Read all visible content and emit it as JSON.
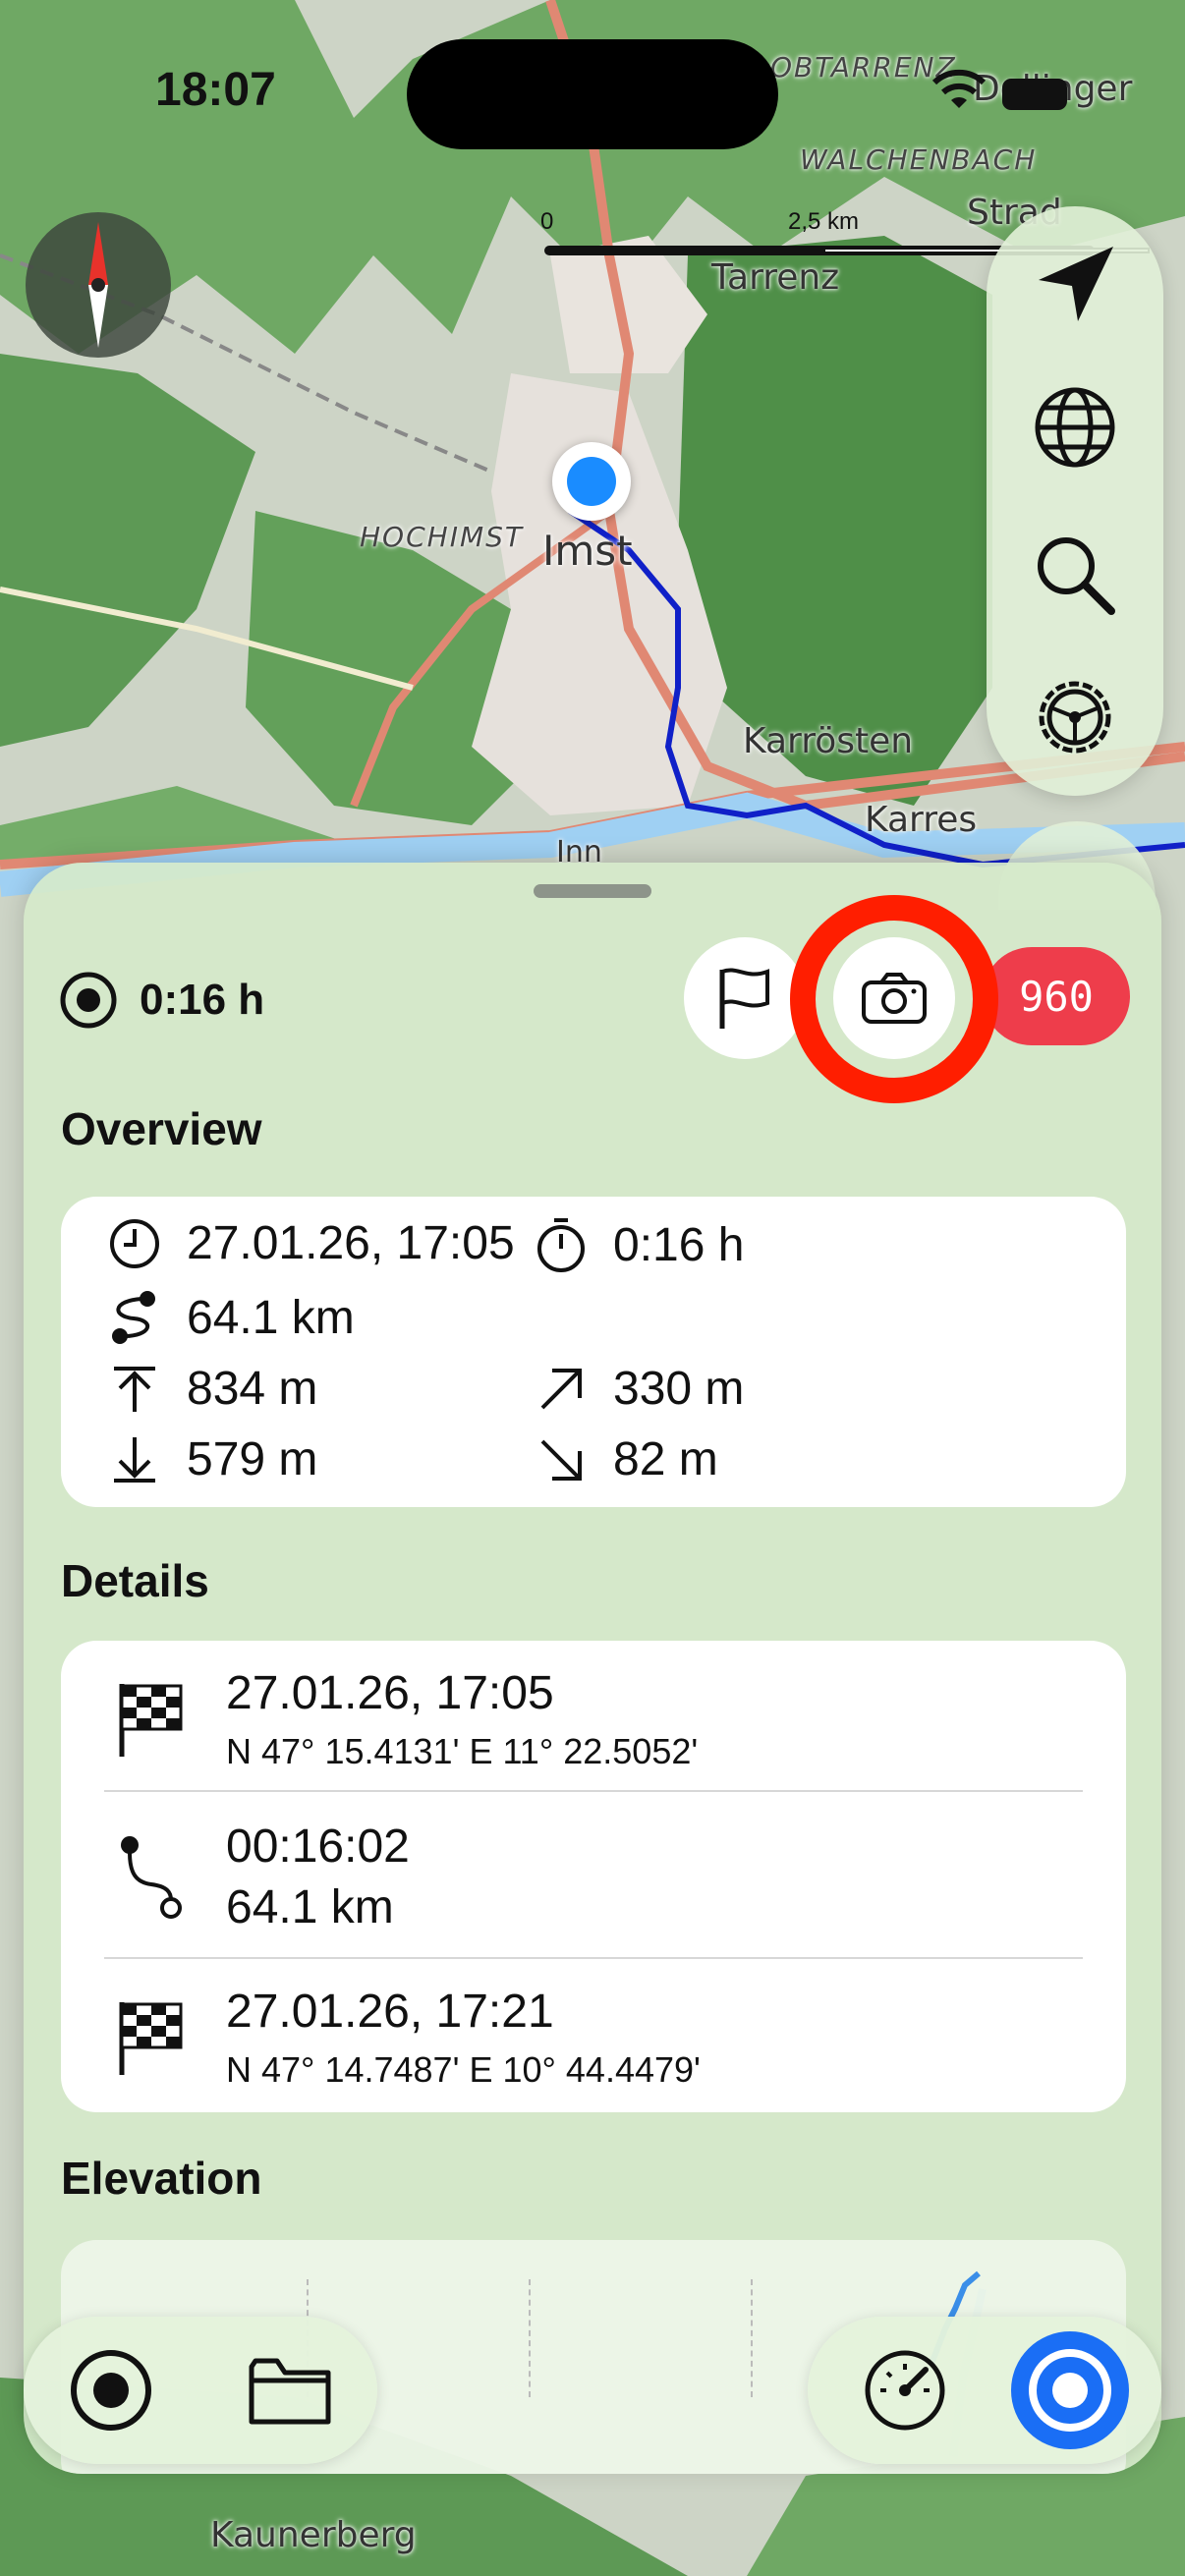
{
  "status_bar": {
    "time": "18:07"
  },
  "map": {
    "scale": {
      "start": "0",
      "mid": "2,5 km"
    },
    "places": {
      "obtarrenz": "OBTARRENZ",
      "dollinger": "Dollinger",
      "walchenbach": "WALCHENBACH",
      "strad": "Strad",
      "tarrenz": "Tarrenz",
      "hochimst": "HOCHIMST",
      "imst": "Imst",
      "karroesten": "Karrösten",
      "karres": "Karres",
      "inn": "Inn",
      "kaunerberg": "Kaunerberg"
    },
    "controls": [
      "location-arrow-icon",
      "globe-icon",
      "search-icon",
      "settings-wheel-icon"
    ]
  },
  "sheet": {
    "recording_duration": "0:16 h",
    "photo_count": "960",
    "overview": {
      "title": "Overview",
      "start_datetime": "27.01.26, 17:05",
      "duration": "0:16 h",
      "distance": "64.1 km",
      "max_elevation": "834 m",
      "ascent": "330 m",
      "min_elevation": "579 m",
      "descent": "82 m"
    },
    "details": {
      "title": "Details",
      "start": {
        "datetime": "27.01.26, 17:05",
        "coords": "N 47° 15.4131' E 11° 22.5052'"
      },
      "segment": {
        "duration": "00:16:02",
        "distance": "64.1 km"
      },
      "end": {
        "datetime": "27.01.26, 17:21",
        "coords": "N 47° 14.7487' E 10° 44.4479'"
      }
    },
    "elevation": {
      "title": "Elevation"
    }
  },
  "bottom_bar": {
    "left": [
      "record-icon",
      "folder-icon"
    ],
    "right": [
      "speedometer-icon",
      "tracking-active-icon"
    ]
  },
  "colors": {
    "accent_blue": "#1a6ef5",
    "recording_pill": "#ee3d4b",
    "highlight_ring": "#ff1e00",
    "track": "#1020c8",
    "sheet_bg": "#d5eaca"
  }
}
